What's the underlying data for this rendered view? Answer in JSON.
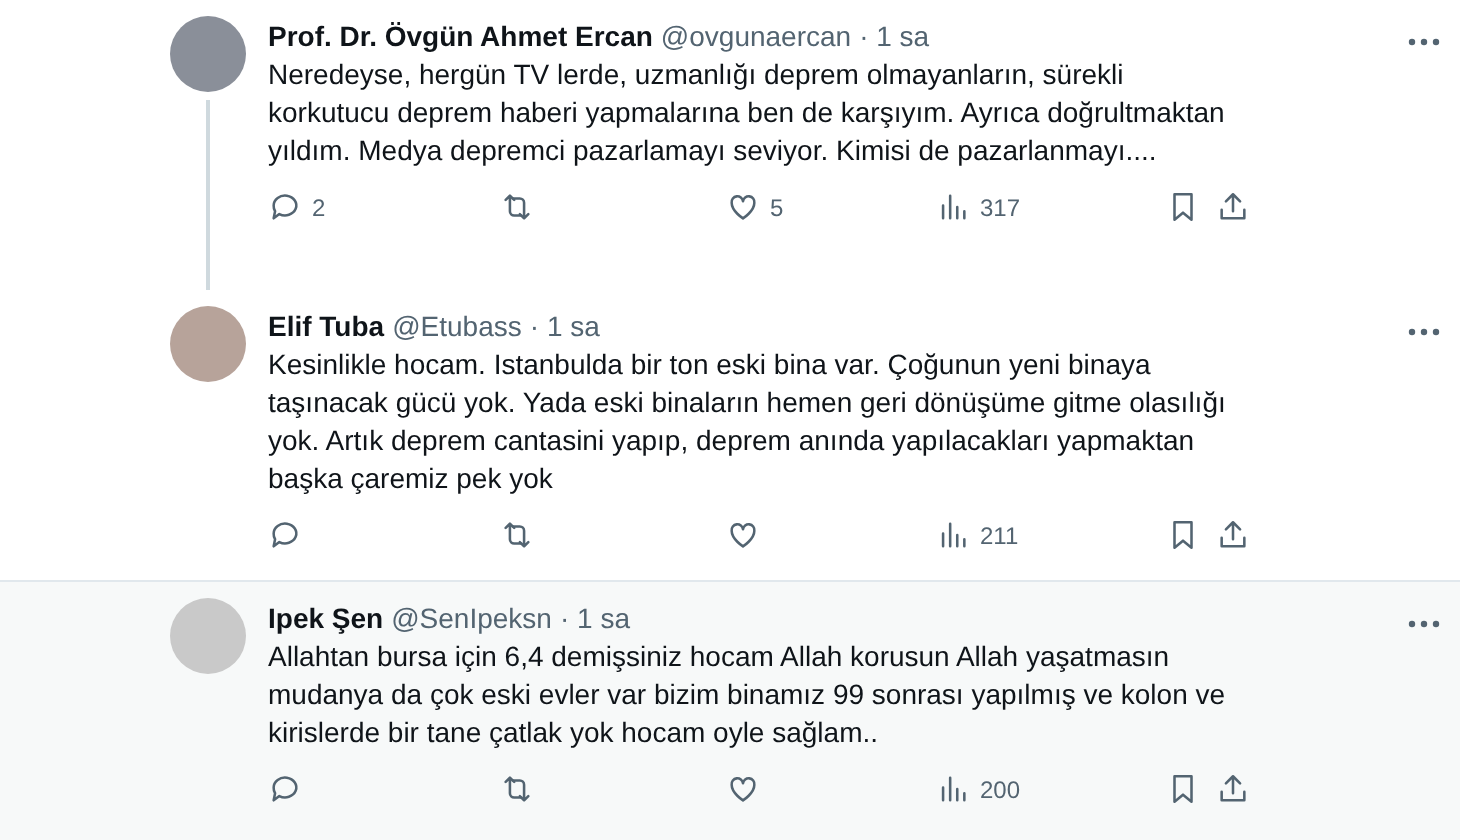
{
  "tweets": [
    {
      "name": "Prof. Dr. Övgün Ahmet Ercan",
      "handle": "@ovgunaercan",
      "time": "· 1 sa",
      "text": "Neredeyse, hergün TV lerde, uzmanlığı deprem olmayanların, sürekli korkutucu deprem haberi yapmalarına ben de karşıyım. Ayrıca doğrultmaktan yıldım. Medya depremci pazarlamayı seviyor. Kimisi de pazarlanmayı....",
      "replies": "2",
      "likes": "5",
      "views": "317",
      "thread_line": true,
      "highlighted": false
    },
    {
      "name": "Elif Tuba",
      "handle": "@Etubass",
      "time": "· 1 sa",
      "text": "Kesinlikle hocam. Istanbulda bir ton eski bina var. Çoğunun yeni binaya taşınacak gücü yok. Yada eski binaların hemen geri dönüşüme gitme olasılığı yok. Artık deprem cantasini yapıp, deprem anında yapılacakları yapmaktan başka çaremiz pek yok",
      "views": "211",
      "thread_line": false,
      "highlighted": false
    },
    {
      "name": "Ipek Şen",
      "handle": "@SenIpeksn",
      "time": "· 1 sa",
      "text": "Allahtan bursa için 6,4 demişsiniz hocam Allah korusun Allah yaşatmasın mudanya da çok eski evler var bizim binamız 99 sonrası yapılmış ve kolon ve kirislerde bir tane çatlak yok hocam oyle sağlam..",
      "views": "200",
      "thread_line": false,
      "highlighted": true
    }
  ]
}
